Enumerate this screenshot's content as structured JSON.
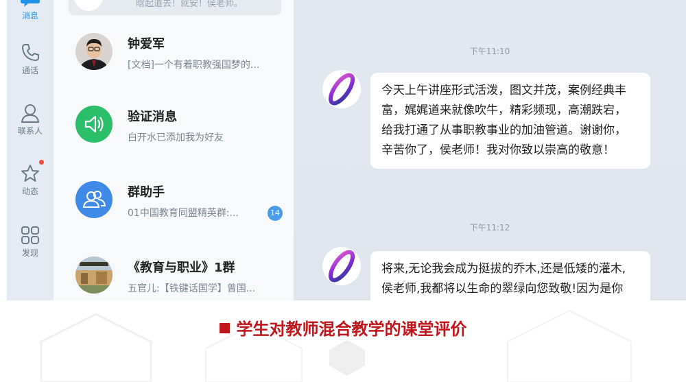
{
  "rail": {
    "items": [
      {
        "label": "消息",
        "icon": "message-icon",
        "active": true
      },
      {
        "label": "通话",
        "icon": "phone-icon",
        "active": false
      },
      {
        "label": "联系人",
        "icon": "contacts-icon",
        "active": false
      },
      {
        "label": "动态",
        "icon": "star-icon",
        "active": false,
        "dot": true
      },
      {
        "label": "发现",
        "icon": "grid-icon",
        "active": false
      }
    ],
    "active_color": "#1f92ea"
  },
  "conversations": {
    "top_partial": {
      "preview": "晗起道去！就安！侯老师。"
    },
    "items": [
      {
        "name": "钟爱军",
        "preview": "[文档]一个有着职教强国梦的..."
      },
      {
        "name": "验证消息",
        "preview": "白开水已添加我为好友",
        "icon": "speaker-icon",
        "icon_bg": "#2cbf6a"
      },
      {
        "name": "群助手",
        "preview": "01中国教育同盟精英群:...",
        "badge": "14",
        "icon": "group-icon",
        "icon_bg": "#3e8ae6"
      },
      {
        "name": "《教育与职业》1群",
        "preview": "五官儿:【铁键话国学】曾国..."
      }
    ]
  },
  "chat": {
    "messages": [
      {
        "time": "下午11:10",
        "lines": [
          "今天上午讲座形式活泼，图文并茂，案例经典丰",
          "富，娓娓道来就像吹牛，精彩频现，高潮跌宕，",
          "给我打通了从事职教事业的加油管道。谢谢你，",
          "辛苦你了，侯老师！我对你致以崇高的敬意！"
        ]
      },
      {
        "time": "下午11:12",
        "lines": [
          "将来,无论我会成为挺拔的乔木,还是低矮的灌木,",
          "侯老师,我都将以生命的翠绿向您致敬!因为是你"
        ]
      }
    ]
  },
  "caption": {
    "text": "学生对教师混合教学的课堂评价",
    "color": "#c0151b"
  }
}
